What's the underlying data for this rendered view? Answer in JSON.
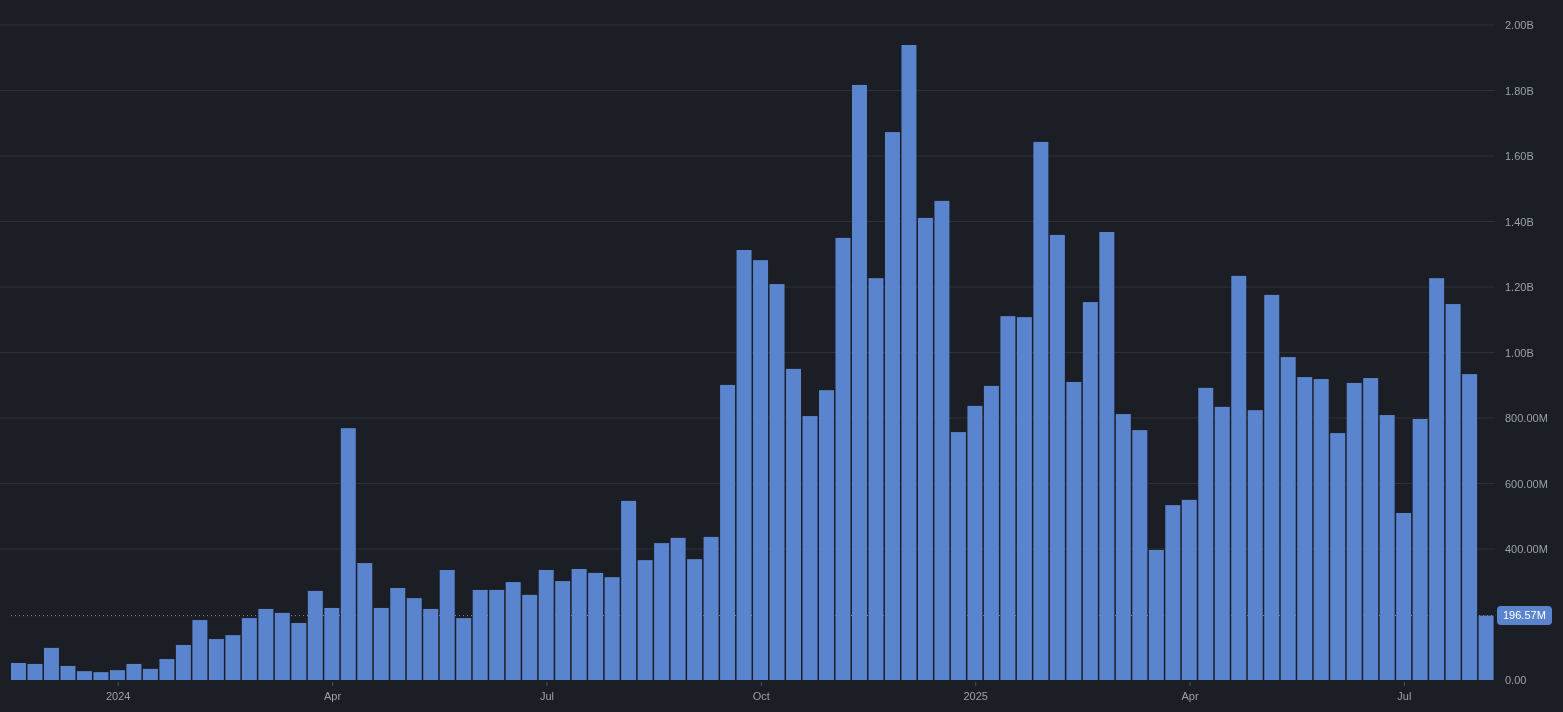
{
  "chart": {
    "chart_data": {
      "type": "bar",
      "categories": [
        null,
        null,
        null,
        null,
        null,
        null,
        "2024",
        null,
        null,
        null,
        null,
        null,
        null,
        null,
        null,
        null,
        null,
        null,
        null,
        "Apr",
        null,
        null,
        null,
        null,
        null,
        null,
        null,
        null,
        null,
        null,
        null,
        null,
        "Jul",
        null,
        null,
        null,
        null,
        null,
        null,
        null,
        null,
        null,
        null,
        null,
        null,
        "Oct",
        null,
        null,
        null,
        null,
        null,
        null,
        null,
        null,
        null,
        null,
        null,
        null,
        "2025",
        null,
        null,
        null,
        null,
        null,
        null,
        null,
        null,
        null,
        null,
        null,
        null,
        "Apr",
        null,
        null,
        null,
        null,
        null,
        null,
        null,
        null,
        null,
        null,
        null,
        null,
        "Jul",
        null,
        null,
        null,
        null,
        null
      ],
      "values": [
        52000000,
        49000000,
        98000000,
        43000000,
        27000000,
        24000000,
        30000000,
        49000000,
        34000000,
        64000000,
        107000000,
        183000000,
        125000000,
        137000000,
        189000000,
        217000000,
        205000000,
        174000000,
        272000000,
        220000000,
        769000000,
        357000000,
        220000000,
        281000000,
        250000000,
        217000000,
        336000000,
        189000000,
        275000000,
        275000000,
        299000000,
        260000000,
        336000000,
        302000000,
        339000000,
        327000000,
        314000000,
        547000000,
        366000000,
        418000000,
        434000000,
        369000000,
        437000000,
        901000000,
        1313000000,
        1282000000,
        1209000000,
        950000000,
        806000000,
        885000000,
        1350000000,
        1817000000,
        1227000000,
        1673000000,
        1939000000,
        1411000000,
        1463000000,
        757000000,
        837000000,
        898000000,
        1111000000,
        1108000000,
        1643000000,
        1359000000,
        910000000,
        1154000000,
        1368000000,
        812000000,
        763000000,
        397000000,
        534000000,
        550000000,
        892000000,
        834000000,
        1234000000,
        824000000,
        1176000000,
        986000000,
        925000000,
        919000000,
        754000000,
        907000000,
        922000000,
        809000000,
        510000000,
        797000000,
        1227000000,
        1148000000,
        934000000,
        196570000
      ],
      "yticks": [
        {
          "value": 0,
          "label": "0.00"
        },
        {
          "value": 400000000,
          "label": "400.00M"
        },
        {
          "value": 600000000,
          "label": "600.00M"
        },
        {
          "value": 800000000,
          "label": "800.00M"
        },
        {
          "value": 1000000000,
          "label": "1.00B"
        },
        {
          "value": 1200000000,
          "label": "1.20B"
        },
        {
          "value": 1400000000,
          "label": "1.40B"
        },
        {
          "value": 1600000000,
          "label": "1.60B"
        },
        {
          "value": 1800000000,
          "label": "1.80B"
        },
        {
          "value": 2000000000,
          "label": "2.00B"
        }
      ],
      "ylim": [
        0,
        2000000000
      ],
      "grid": true,
      "ref_lines": [
        {
          "axis": "y",
          "value": 196570000,
          "label": "196.57M"
        }
      ]
    }
  }
}
